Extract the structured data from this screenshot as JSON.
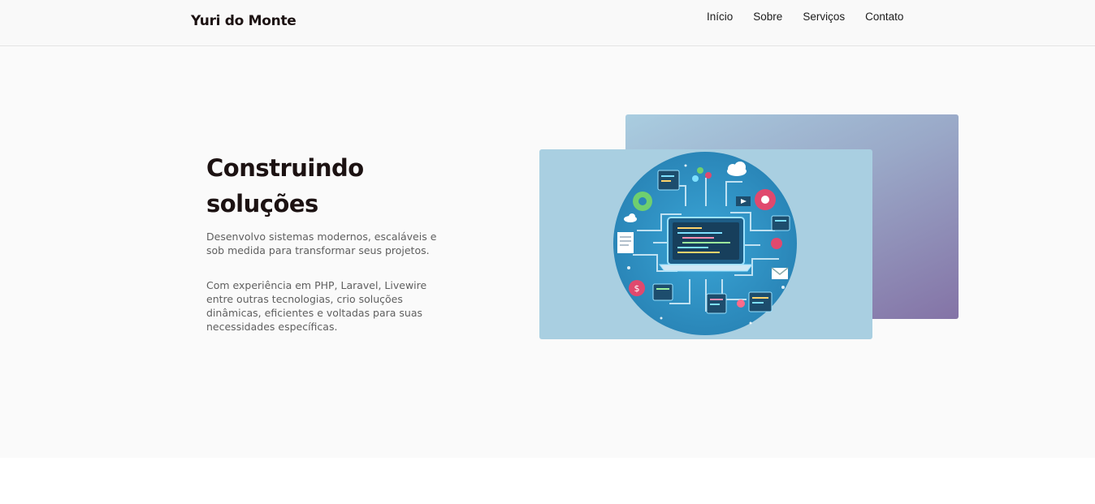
{
  "header": {
    "brand": "Yuri do Monte",
    "nav": [
      {
        "label": "Início"
      },
      {
        "label": "Sobre"
      },
      {
        "label": "Serviços"
      },
      {
        "label": "Contato"
      }
    ]
  },
  "hero": {
    "title_line1": "Construindo",
    "title_line2": "soluções",
    "paragraph1": "Desenvolvo sistemas modernos, escaláveis e sob medida para transformar seus projetos.",
    "paragraph2": "Com experiência em PHP, Laravel, Livewire entre outras tecnologias, crio soluções dinâmicas, eficientes e voltadas para suas necessidades específicas."
  },
  "colors": {
    "accent_gradient_start": "#a9cde0",
    "accent_gradient_end": "#8473a6",
    "image_bg": "#a9cfe1",
    "circle": "#2f8fbf"
  }
}
